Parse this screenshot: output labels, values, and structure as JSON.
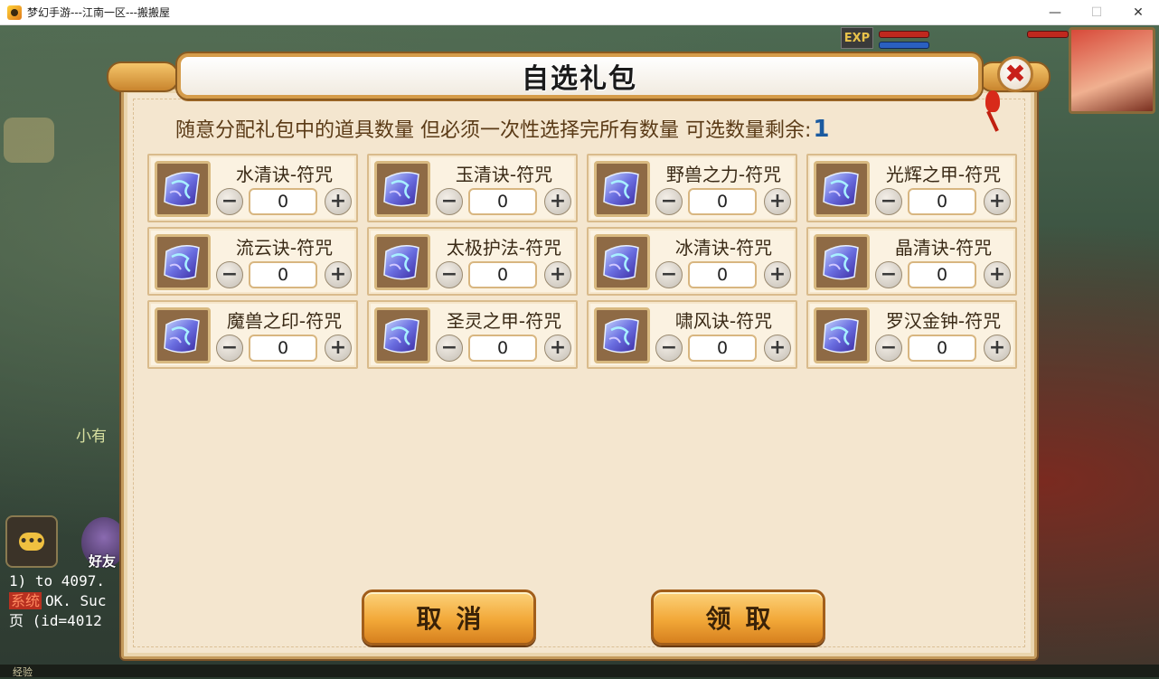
{
  "window": {
    "title": "梦幻手游---江南一区---搬搬屋",
    "minimize": "—",
    "maximize": "☐",
    "close": "✕"
  },
  "hud": {
    "exp_label": "EXP",
    "side_text": "小有",
    "friend_label": "好友",
    "chat_icon": "•••",
    "bottom_exp_label": "经验",
    "chat_log": {
      "line1": "1) to 4097.",
      "sys_tag": "系统",
      "line2": "OK. Suc",
      "line3": "页 (id=4012"
    }
  },
  "dialog": {
    "title": "自选礼包",
    "close_icon": "✖",
    "instruction": "随意分配礼包中的道具数量 但必须一次性选择完所有数量  可选数量剩余:",
    "remaining": "1",
    "items": [
      {
        "name": "水清诀-符咒",
        "qty": "0"
      },
      {
        "name": "玉清诀-符咒",
        "qty": "0"
      },
      {
        "name": "野兽之力-符咒",
        "qty": "0"
      },
      {
        "name": "光辉之甲-符咒",
        "qty": "0"
      },
      {
        "name": "流云诀-符咒",
        "qty": "0"
      },
      {
        "name": "太极护法-符咒",
        "qty": "0"
      },
      {
        "name": "冰清诀-符咒",
        "qty": "0"
      },
      {
        "name": "晶清诀-符咒",
        "qty": "0"
      },
      {
        "name": "魔兽之印-符咒",
        "qty": "0"
      },
      {
        "name": "圣灵之甲-符咒",
        "qty": "0"
      },
      {
        "name": "啸风诀-符咒",
        "qty": "0"
      },
      {
        "name": "罗汉金钟-符咒",
        "qty": "0"
      }
    ],
    "minus_symbol": "−",
    "plus_symbol": "+",
    "cancel_label": "取消",
    "claim_label": "领取"
  },
  "icons": {
    "item": "talisman-scroll-icon"
  },
  "colors": {
    "dialog_bg": "#f4e6cf",
    "button_orange": "#f2a838",
    "remaining_blue": "#1a5aa0",
    "close_red": "#c8201a"
  }
}
